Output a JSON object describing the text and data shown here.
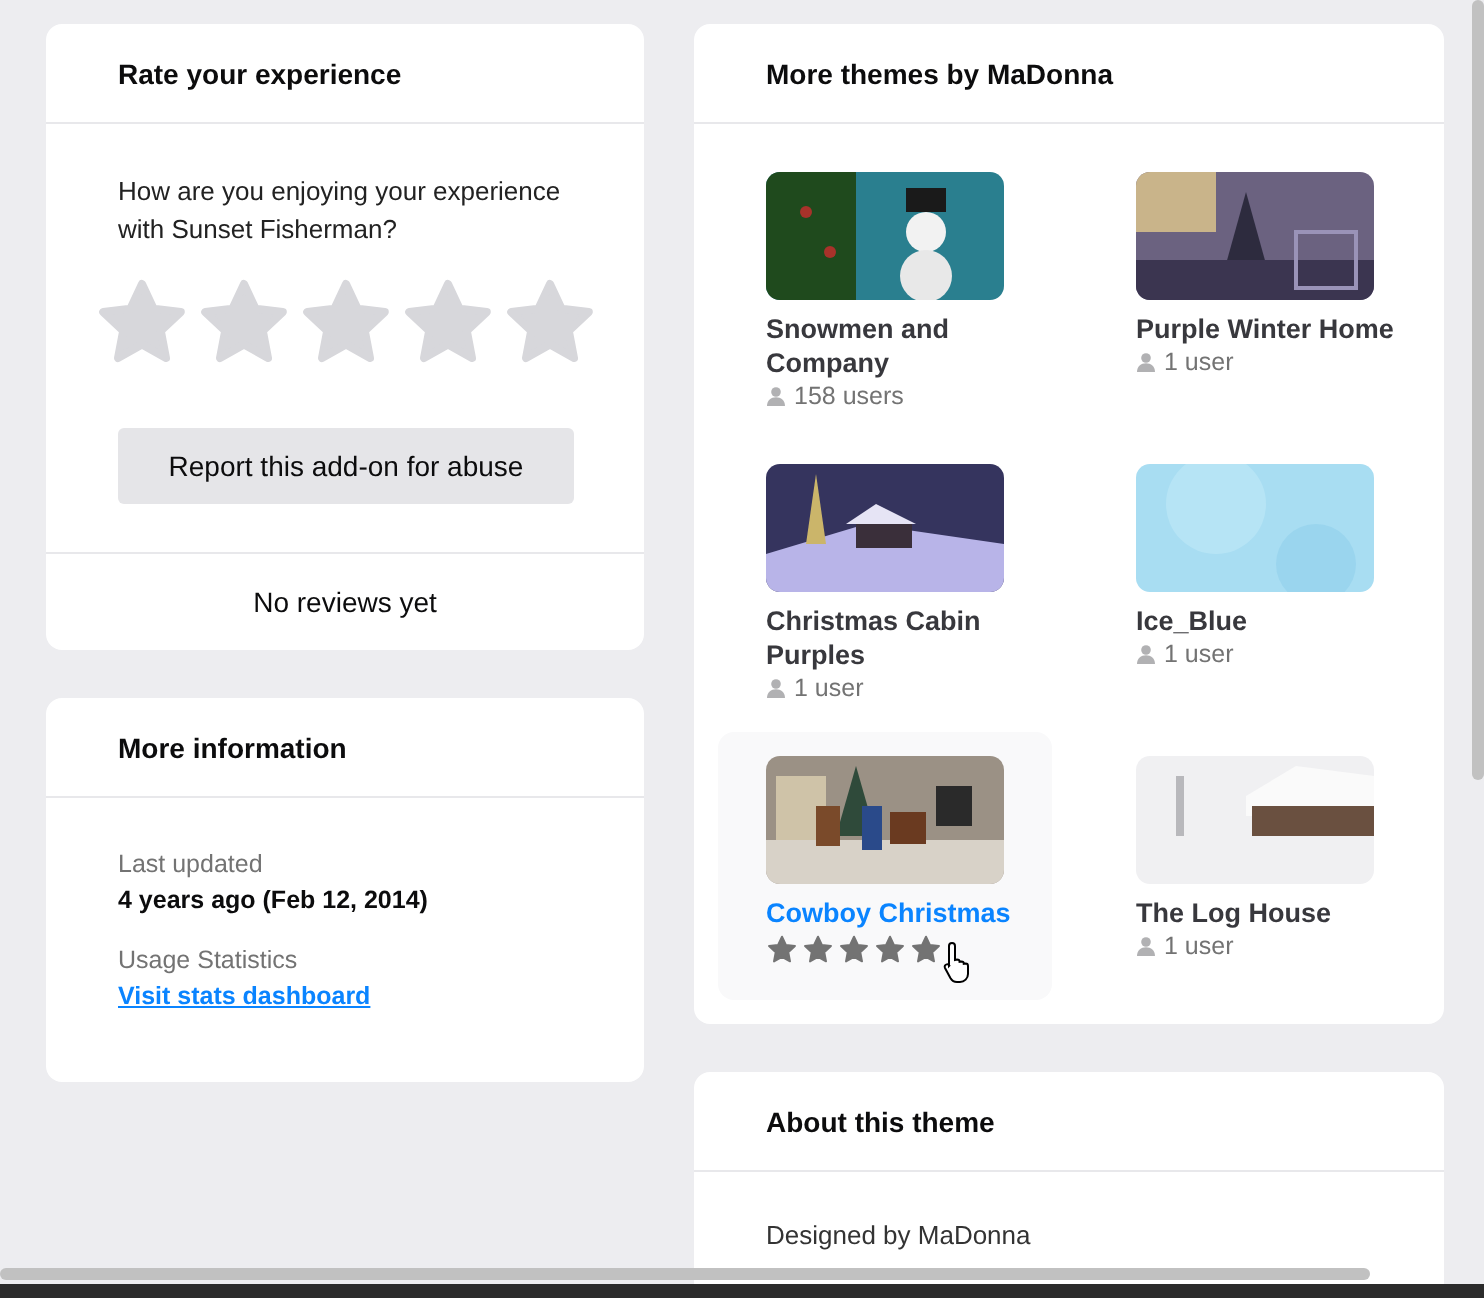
{
  "rate_card": {
    "title": "Rate your experience",
    "question": "How are you enjoying your experience with Sunset Fisherman?",
    "stars": 0,
    "report_button": "Report this add-on for abuse",
    "reviews": "No reviews yet"
  },
  "info_card": {
    "title": "More information",
    "fields": [
      {
        "label": "Last updated",
        "value": "4 years ago (Feb 12, 2014)",
        "kind": "text"
      },
      {
        "label": "Usage Statistics",
        "value": "Visit stats dashboard",
        "kind": "link"
      }
    ]
  },
  "themes_card": {
    "title": "More themes by MaDonna",
    "themes": [
      {
        "name": "Snowmen and Company",
        "users": "158 users",
        "hovered": false
      },
      {
        "name": "Purple Winter Home",
        "users": "1 user",
        "hovered": false
      },
      {
        "name": "Christmas Cabin Purples",
        "users": "1 user",
        "hovered": false
      },
      {
        "name": "Ice_Blue",
        "users": "1 user",
        "hovered": false
      },
      {
        "name": "Cowboy Christmas",
        "stars": 5,
        "hovered": true
      },
      {
        "name": "The Log House",
        "users": "1 user",
        "hovered": false
      }
    ]
  },
  "about_card": {
    "title": "About this theme",
    "text": "Designed by MaDonna"
  }
}
